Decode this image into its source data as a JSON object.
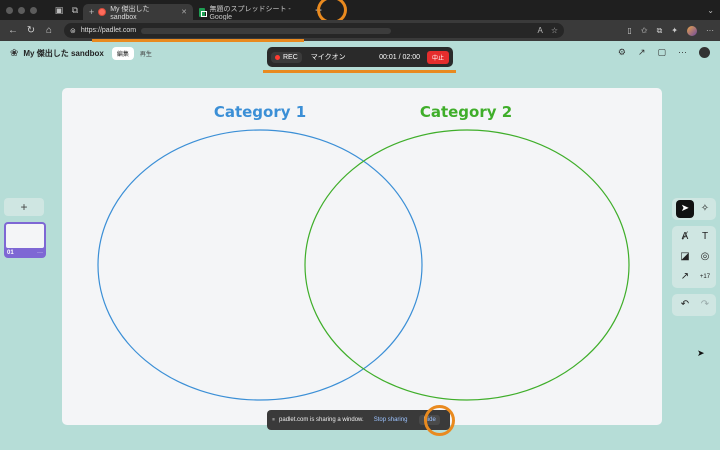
{
  "browser": {
    "tabs": [
      {
        "label": "My 傑出した sandbox",
        "active": true
      },
      {
        "label": "無題のスプレッドシート - Google",
        "active": false
      }
    ],
    "new_tab_icon": "plus-icon",
    "url": "https://padlet.com"
  },
  "app": {
    "title": "My 傑出した sandbox",
    "mode_edit": "編集",
    "mode_play": "再生"
  },
  "recorder": {
    "rec_label": "REC",
    "mic_label": "マイクオン",
    "time": "00:01 / 02:00",
    "stop_label": "中止"
  },
  "canvas": {
    "category1": "Category 1",
    "category2": "Category 2",
    "colors": {
      "category1": "#3b8fd6",
      "category2": "#3fae2a"
    }
  },
  "slides": {
    "add_label": "+",
    "items": [
      {
        "number": "01",
        "more": "···"
      }
    ]
  },
  "toolbar": {
    "more_count": "+17"
  },
  "share_bar": {
    "message": "padlet.com is sharing a window.",
    "stop_label": "Stop sharing",
    "hide_label": "Hide"
  }
}
